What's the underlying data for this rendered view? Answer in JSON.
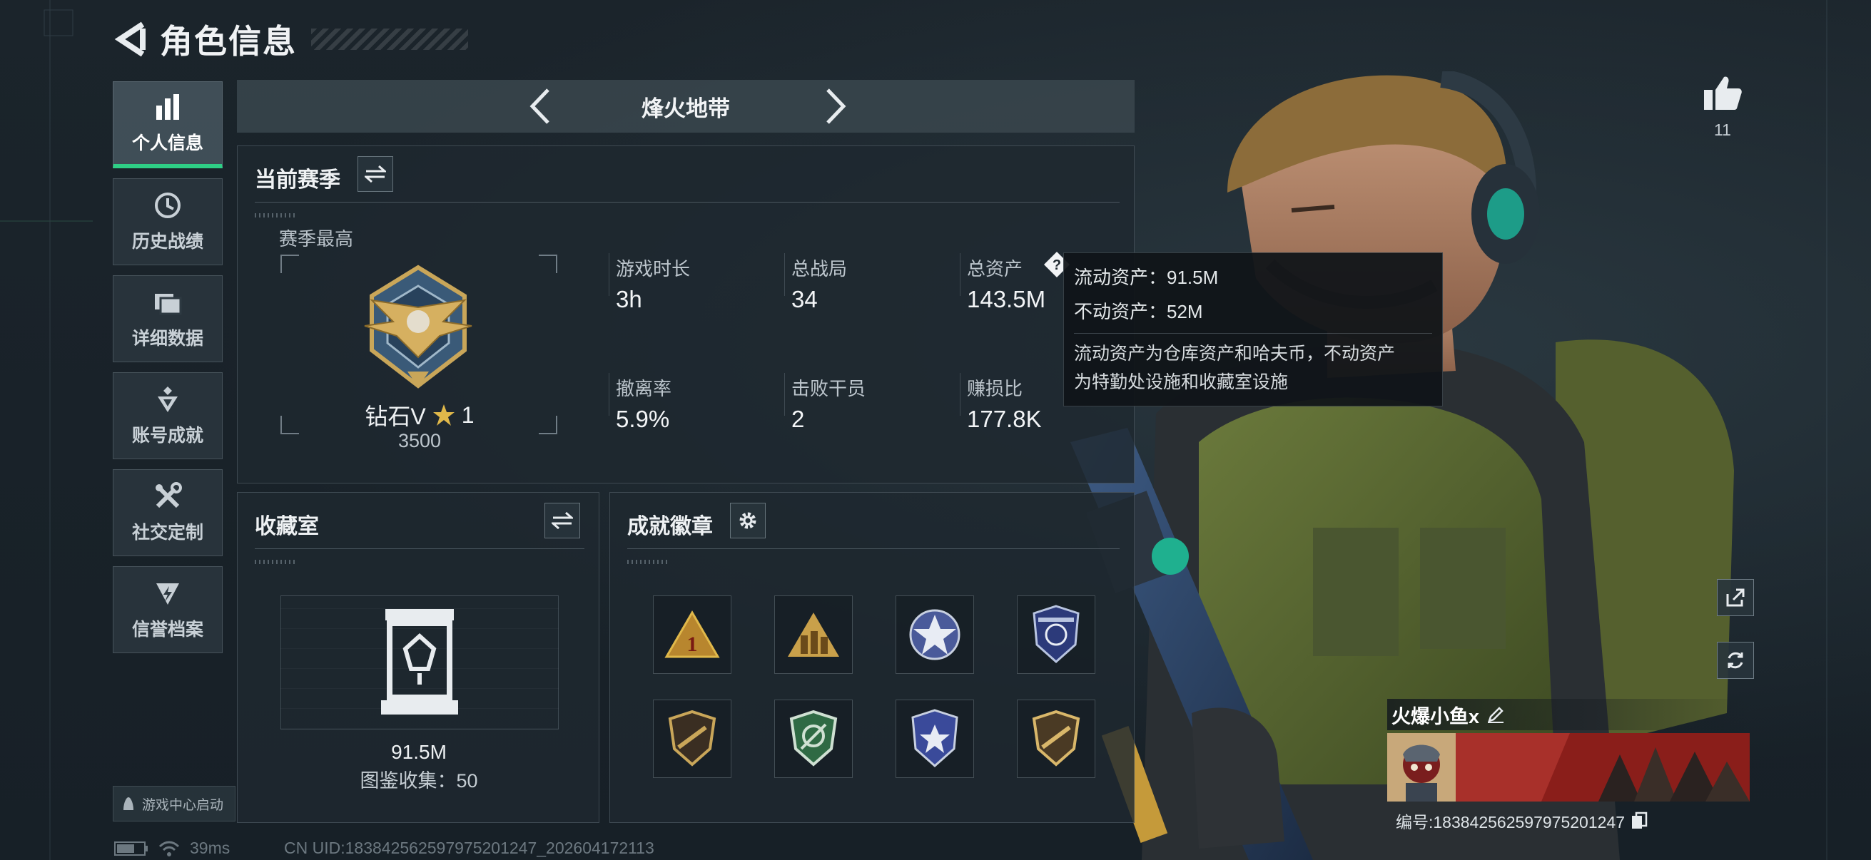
{
  "header": {
    "title": "角色信息"
  },
  "sidebar": {
    "items": [
      {
        "label": "个人信息",
        "icon": "bar-chart-icon",
        "active": true
      },
      {
        "label": "历史战绩",
        "icon": "history-icon",
        "active": false
      },
      {
        "label": "详细数据",
        "icon": "folder-icon",
        "active": false
      },
      {
        "label": "账号成就",
        "icon": "achievement-icon",
        "active": false
      },
      {
        "label": "社交定制",
        "icon": "tools-icon",
        "active": false
      },
      {
        "label": "信誉档案",
        "icon": "credit-icon",
        "active": false
      }
    ],
    "game_center": "游戏中心启动"
  },
  "status": {
    "latency": "39ms",
    "uid": "CN UID:18384256259797520124​7_202604172113"
  },
  "mode": {
    "title": "烽火地带"
  },
  "season": {
    "title": "当前赛季",
    "best_label": "赛季最高",
    "rank_name": "钻石V",
    "rank_star_count": "1",
    "rank_points": "3500",
    "stats": [
      {
        "label": "游戏时长",
        "value": "3h"
      },
      {
        "label": "总战局",
        "value": "34"
      },
      {
        "label": "总资产",
        "value": "143.5M"
      },
      {
        "label": "撤离率",
        "value": "5.9%"
      },
      {
        "label": "击败干员",
        "value": "2"
      },
      {
        "label": "赚损比",
        "value": "177.8K"
      }
    ]
  },
  "tooltip": {
    "liquid": "流动资产：91.5M",
    "fixed": "不动资产：52M",
    "desc_line1": "流动资产为仓库资产和哈夫币，不动资产",
    "desc_line2": "为特勤处设施和收藏室设施"
  },
  "collection": {
    "title": "收藏室",
    "value": "91.5M",
    "catalog": "图鉴收集：50"
  },
  "badges": {
    "title": "成就徽章"
  },
  "profile": {
    "likes": "11",
    "name": "火爆小鱼x",
    "id": "编号:18384256259797520124​7"
  },
  "colors": {
    "accent": "#2ecf86",
    "panel": "#1e282f",
    "tooltip_bg": "#101418"
  }
}
